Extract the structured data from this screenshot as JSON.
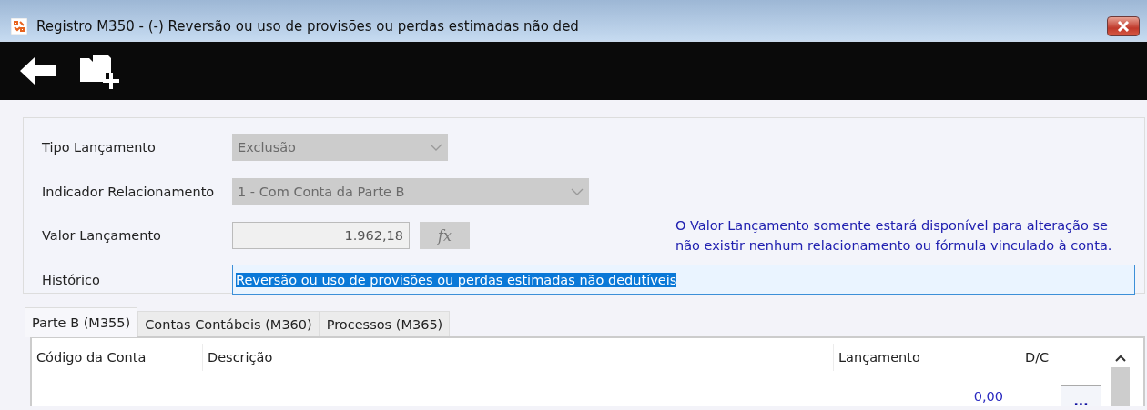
{
  "window": {
    "title": "Registro M350 - (-) Reversão ou uso de provisões ou perdas estimadas não ded"
  },
  "toolbar": {
    "buttons": [
      {
        "kind": "back"
      },
      {
        "kind": "new-folder"
      }
    ]
  },
  "form": {
    "fields": [
      {
        "kind": "select",
        "label": "Tipo Lançamento",
        "value": "Exclusão",
        "disabled": true
      },
      {
        "kind": "select",
        "label": "Indicador Relacionamento",
        "value": "1 - Com Conta da Parte B",
        "disabled": true
      },
      {
        "kind": "number",
        "label": "Valor Lançamento",
        "value": "1.962,18",
        "disabled": true,
        "button": "fx",
        "note": "O Valor Lançamento somente estará disponível para alteração se não existir nenhum relacionamento ou fórmula vinculado à conta."
      },
      {
        "kind": "text",
        "label": "Histórico",
        "value": "Reversão ou uso de provisões ou perdas estimadas não dedutíveis",
        "text_selected": true
      }
    ]
  },
  "tabs": [
    {
      "label": "Parte B (M355)",
      "selected": true
    },
    {
      "label": "Contas Contábeis (M360)",
      "selected": false
    },
    {
      "label": "Processos (M365)",
      "selected": false
    }
  ],
  "table": {
    "columns": [
      "Código da Conta",
      "Descrição",
      "Lançamento",
      "D/C"
    ],
    "rows": [
      {
        "cells": [
          "",
          "",
          "0,00",
          ""
        ],
        "action": "..."
      }
    ]
  }
}
